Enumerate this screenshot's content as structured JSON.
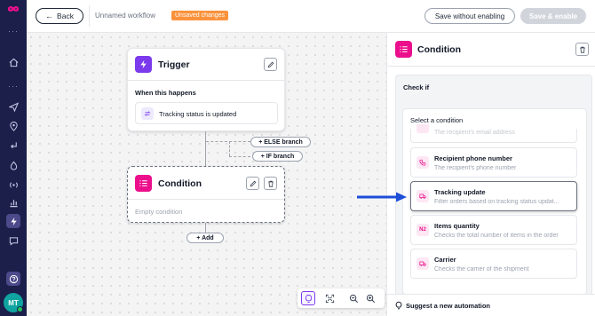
{
  "sidebar": {
    "logo": "infinity-logo",
    "dots": "···",
    "items": [
      {
        "icon": "home-icon"
      },
      {
        "icon": "send-icon"
      },
      {
        "icon": "location-icon"
      },
      {
        "icon": "return-icon"
      },
      {
        "icon": "drop-icon"
      },
      {
        "icon": "broadcast-icon"
      },
      {
        "icon": "chart-icon"
      },
      {
        "icon": "lightning-icon",
        "active": true
      },
      {
        "icon": "chat-icon"
      }
    ],
    "help_icon": "help-icon",
    "avatar_initials": "MT"
  },
  "topbar": {
    "back_label": "Back",
    "workflow_name": "Unnamed workflow",
    "unsaved_badge": "Unsaved changes",
    "save_without_enabling": "Save without enabling",
    "save_and_enable": "Save & enable"
  },
  "canvas": {
    "trigger": {
      "title": "Trigger",
      "when_label": "When this happens",
      "event": "Tracking status is updated"
    },
    "else_branch": "+ ELSE branch",
    "if_branch": "+ IF branch",
    "condition": {
      "title": "Condition",
      "empty": "Empty condition"
    },
    "add_label": "+ Add"
  },
  "panel": {
    "title": "Condition",
    "check_if": "Check if",
    "select_label": "Select a condition",
    "partial_item_desc": "The recipient's email address",
    "options": [
      {
        "title": "Recipient phone number",
        "desc": "The recipient's phone number",
        "icon": "phone-icon"
      },
      {
        "title": "Tracking update",
        "desc": "Filter orders based on tracking status updat...",
        "icon": "truck-icon",
        "selected": true
      },
      {
        "title": "Items quantity",
        "desc": "Checks the total number of items in the order",
        "icon": "N2"
      },
      {
        "title": "Carrier",
        "desc": "Checks the carrier of the shipment",
        "icon": "truck-icon"
      }
    ],
    "suggest": "Suggest a new automation"
  },
  "colors": {
    "sidebar_bg": "#1b1f4a",
    "trigger_accent": "#7c3aed",
    "condition_accent": "#ec0f8c",
    "unsaved_badge": "#fb923c",
    "arrow": "#1d4ed8"
  }
}
